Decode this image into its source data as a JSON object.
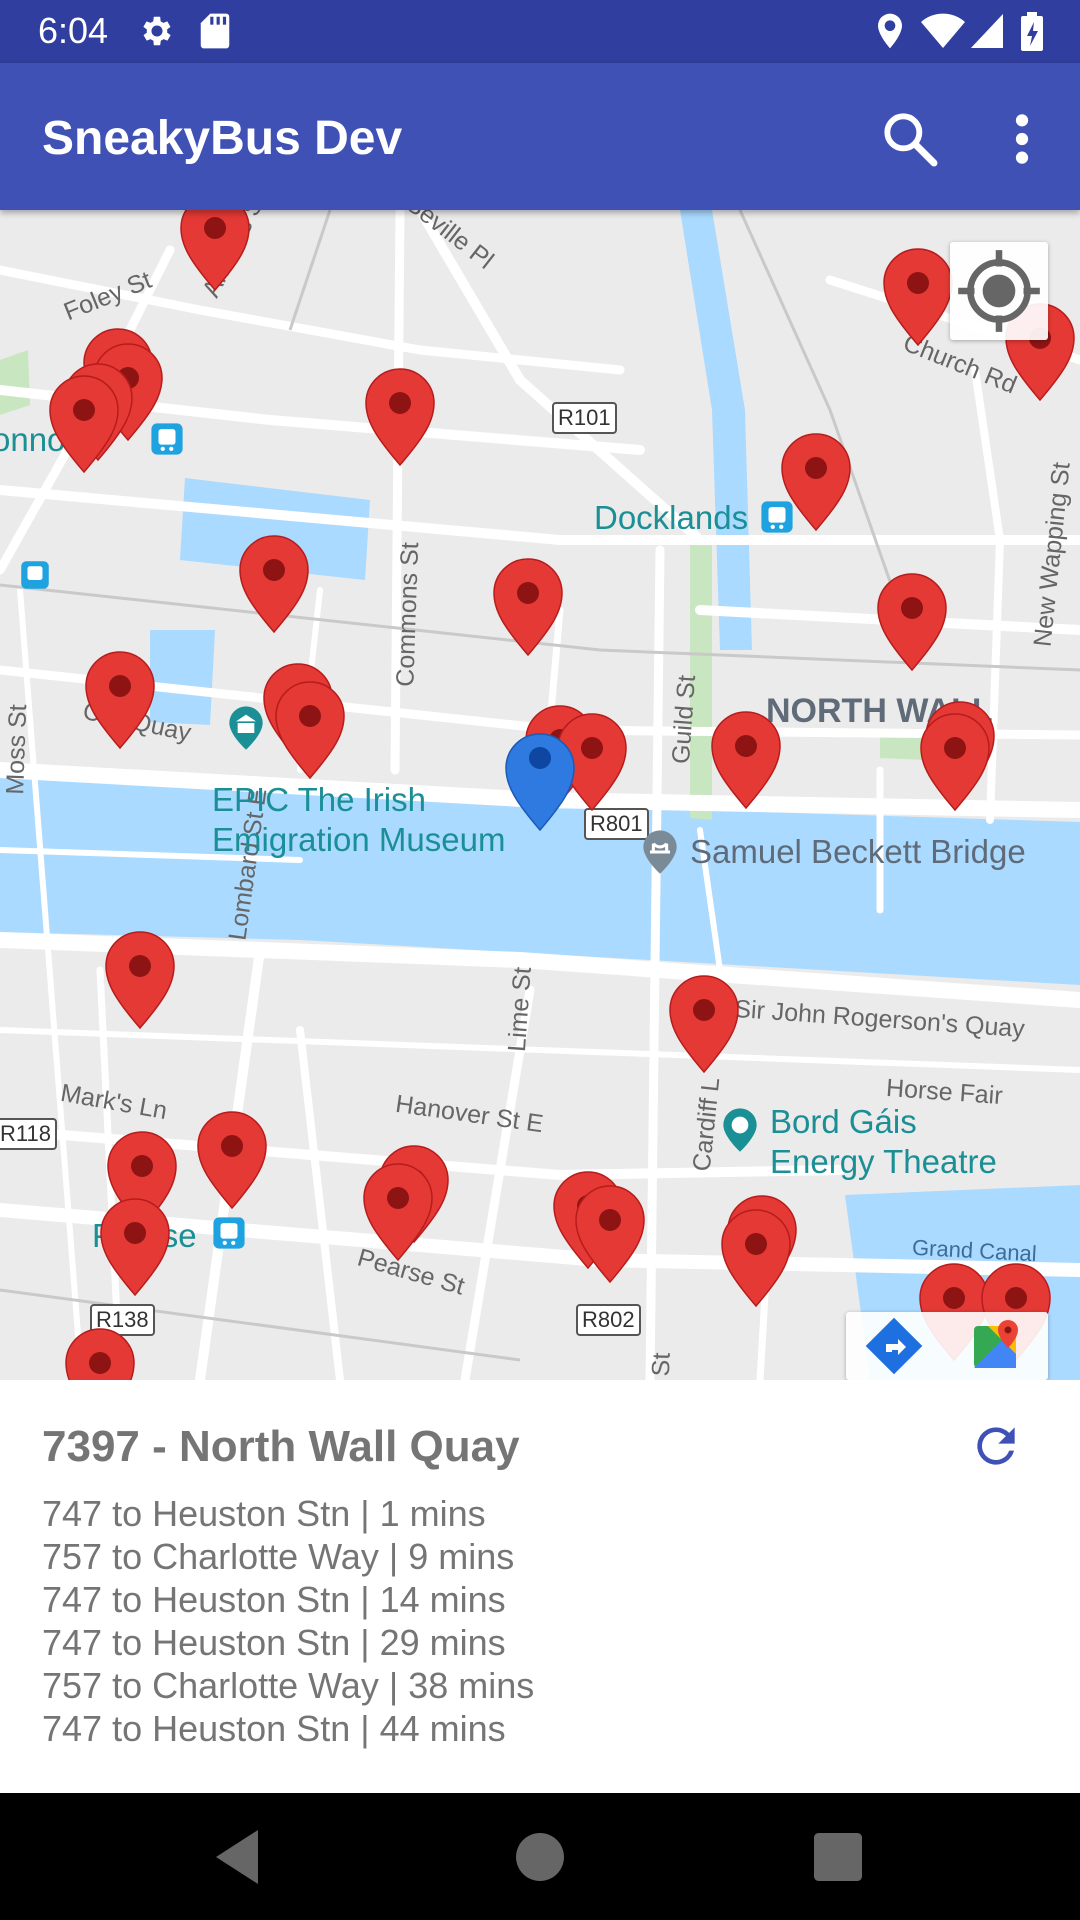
{
  "status_bar": {
    "time": "6:04",
    "left_icons": [
      "gear-icon",
      "sd-card-icon"
    ],
    "right_icons": [
      "location-pin-icon",
      "wifi-icon",
      "signal-icon",
      "battery-icon"
    ]
  },
  "app_bar": {
    "title": "SneakyBus Dev",
    "actions": [
      "search-icon",
      "more-vert-icon"
    ]
  },
  "map": {
    "streets": [
      "Foley St",
      "Amiens St",
      "Seville Pl",
      "Church Rd",
      "Commons St",
      "Guild St",
      "New Wapping St",
      "City Quay",
      "Moss St",
      "Lombard St E",
      "Lime St",
      "Sir John Rogerson's Quay",
      "Hanover St E",
      "Mark's Ln",
      "Pearse St",
      "Cardiff L",
      "St",
      "Horse Fair"
    ],
    "route_shields": [
      "R101",
      "R801",
      "R118",
      "R138",
      "R802"
    ],
    "places": [
      "Docklands",
      "EPIC The Irish",
      "Emigration Museum",
      "Samuel Beckett Bridge",
      "Bord Gáis",
      "Energy Theatre",
      "Pearse",
      "onnol"
    ],
    "district": "NORTH WALL",
    "water": "Grand Canal",
    "selected_marker_color": "#2e7ae0",
    "marker_color": "#e53935",
    "controls": [
      "my-location-icon",
      "directions-icon",
      "google-maps-icon"
    ]
  },
  "panel": {
    "stop_title": "7397 - North Wall Quay",
    "arrivals": [
      "747 to Heuston Stn | 1 mins",
      "757 to Charlotte Way | 9 mins",
      "747 to Heuston Stn | 14 mins",
      "747 to Heuston Stn | 29 mins",
      "757 to Charlotte Way | 38 mins",
      "747 to Heuston Stn | 44 mins"
    ],
    "refresh_icon": "refresh-icon",
    "accent": "#3f51b5"
  },
  "nav_bar": [
    "back-icon",
    "home-icon",
    "recents-icon"
  ]
}
